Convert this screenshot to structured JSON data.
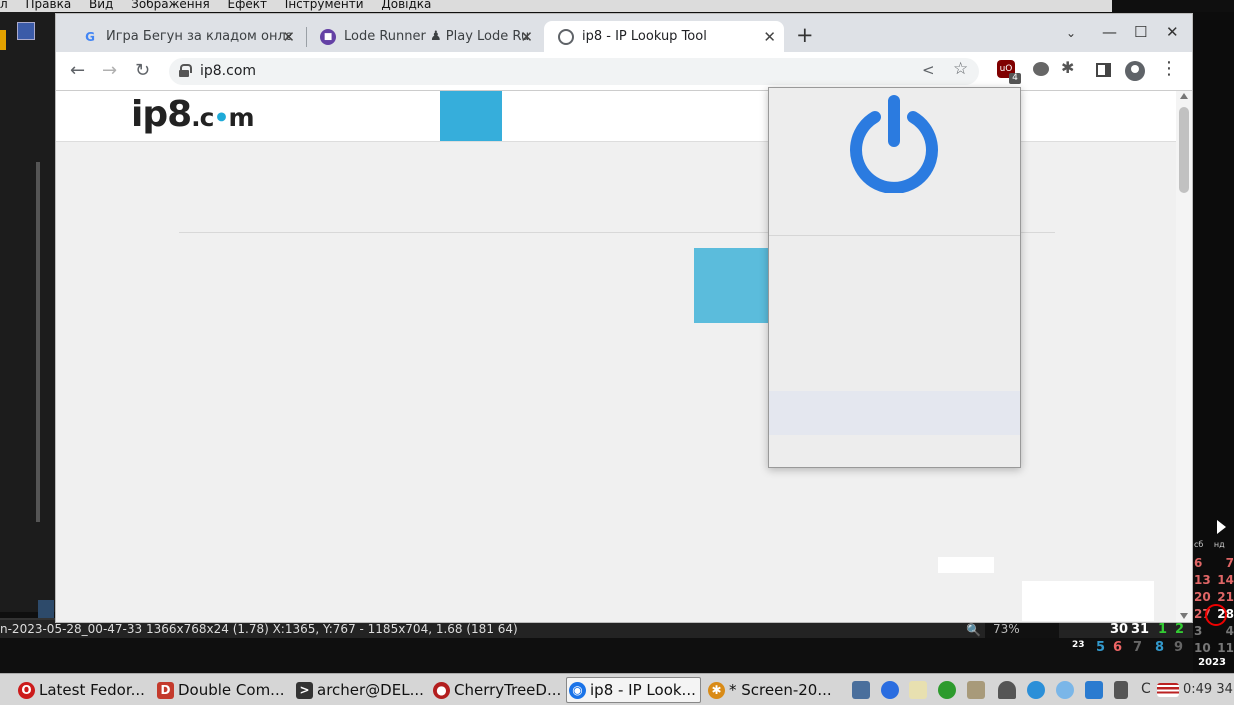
{
  "background_app": {
    "menu": [
      "л",
      "Правка",
      "Вид",
      "Зображення",
      "Ефект",
      "Інструменти",
      "Довідка"
    ],
    "status_text": "n-2023-05-28_00-47-33  1366x768x24 (1.78)  X:1365, Y:767 - 1185x704, 1.68 (181 64)",
    "zoom_value": "73%"
  },
  "calendar": {
    "day_headers": "сб нд",
    "rows": [
      [
        "6",
        "7"
      ],
      [
        "13",
        "14"
      ],
      [
        "20",
        "21"
      ],
      [
        "27",
        "28"
      ],
      [
        "3",
        "4"
      ],
      [
        "10",
        "11"
      ]
    ],
    "year": "2023",
    "today": "28"
  },
  "bottom_numbers": {
    "top_row": [
      "30",
      "31",
      "1",
      "2"
    ],
    "bottom_row": [
      "23",
      "5",
      "6",
      "7",
      "8",
      "9"
    ]
  },
  "browser": {
    "tabs": [
      {
        "title": "Игра Бегун за кладом онлайн",
        "favicon": "google-icon",
        "active": false
      },
      {
        "title": "Lode Runner ♟ Play Lode Runner",
        "favicon": "twitch-icon",
        "active": false
      },
      {
        "title": "ip8 - IP Lookup Tool",
        "favicon": "globe-icon",
        "active": true
      }
    ],
    "new_tab": "+",
    "tabs_dropdown": "⌄",
    "window_controls": {
      "minimize": "—",
      "maximize": "☐",
      "close": "✕"
    },
    "nav": {
      "back": "←",
      "forward": "→",
      "reload": "↻"
    },
    "url": "ip8.com",
    "extensions": {
      "ublock_badge": "4"
    }
  },
  "page": {
    "logo_prefix": "ip8",
    "logo_suffix_1": ".c",
    "logo_dot": "•",
    "logo_suffix_2": "m"
  },
  "taskbar": {
    "items": [
      {
        "label": "Latest Fedor...",
        "icon": "opera-icon",
        "color": "#cc1b1b"
      },
      {
        "label": "Double Com...",
        "icon": "double-commander-icon",
        "color": "#c43a2c"
      },
      {
        "label": "archer@DEL...",
        "icon": "terminal-icon",
        "color": "#333333"
      },
      {
        "label": "CherryTreeD...",
        "icon": "cherry-icon",
        "color": "#b31e1e"
      },
      {
        "label": "ip8 - IP Look...",
        "icon": "chrome-icon",
        "color": "#1a73e8",
        "active": true
      },
      {
        "label": "* Screen-20...",
        "icon": "image-viewer-icon",
        "color": "#d98b17"
      }
    ],
    "tray_text": "C",
    "clock": "0:49 34"
  }
}
